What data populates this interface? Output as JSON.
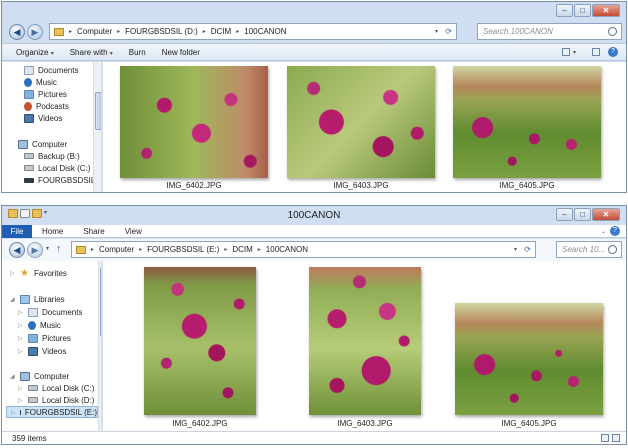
{
  "win1": {
    "search_placeholder": "Search 100CANON",
    "breadcrumb": [
      "Computer",
      "FOURGBSDSIL (D:)",
      "DCIM",
      "100CANON"
    ],
    "toolbar": {
      "organize": "Organize",
      "share": "Share with",
      "burn": "Burn",
      "newfolder": "New folder"
    },
    "sidebar": [
      "Documents",
      "Music",
      "Pictures",
      "Podcasts",
      "Videos",
      "Computer",
      "Backup (B:)",
      "Local Disk (C:)",
      "FOURGBSDSIL (D:"
    ],
    "files": [
      "IMG_6402.JPG",
      "IMG_6403.JPG",
      "IMG_6405.JPG"
    ]
  },
  "win2": {
    "title": "100CANON",
    "ribbon": {
      "file": "File",
      "home": "Home",
      "share": "Share",
      "view": "View"
    },
    "breadcrumb": [
      "Computer",
      "FOURGBSDSIL (E:)",
      "DCIM",
      "100CANON"
    ],
    "search_placeholder": "Search 10...",
    "sidebar": [
      "Favorites",
      "Libraries",
      "Documents",
      "Music",
      "Pictures",
      "Videos",
      "Computer",
      "Local Disk (C:)",
      "Local Disk (D:)",
      "FOURGBSDSIL (E:)"
    ],
    "files": [
      "IMG_6402.JPG",
      "IMG_6403.JPG",
      "IMG_6405.JPG"
    ],
    "status": "359 items"
  },
  "colors": {
    "flower": "#b01a6a",
    "foliage": "#6f9a3c",
    "frame": "#cfdff1"
  },
  "icons": [
    "back-arrow-icon",
    "forward-arrow-icon",
    "folder-icon",
    "search-icon",
    "minimize-icon",
    "maximize-icon",
    "close-icon",
    "help-icon",
    "views-icon",
    "up-arrow-icon"
  ]
}
